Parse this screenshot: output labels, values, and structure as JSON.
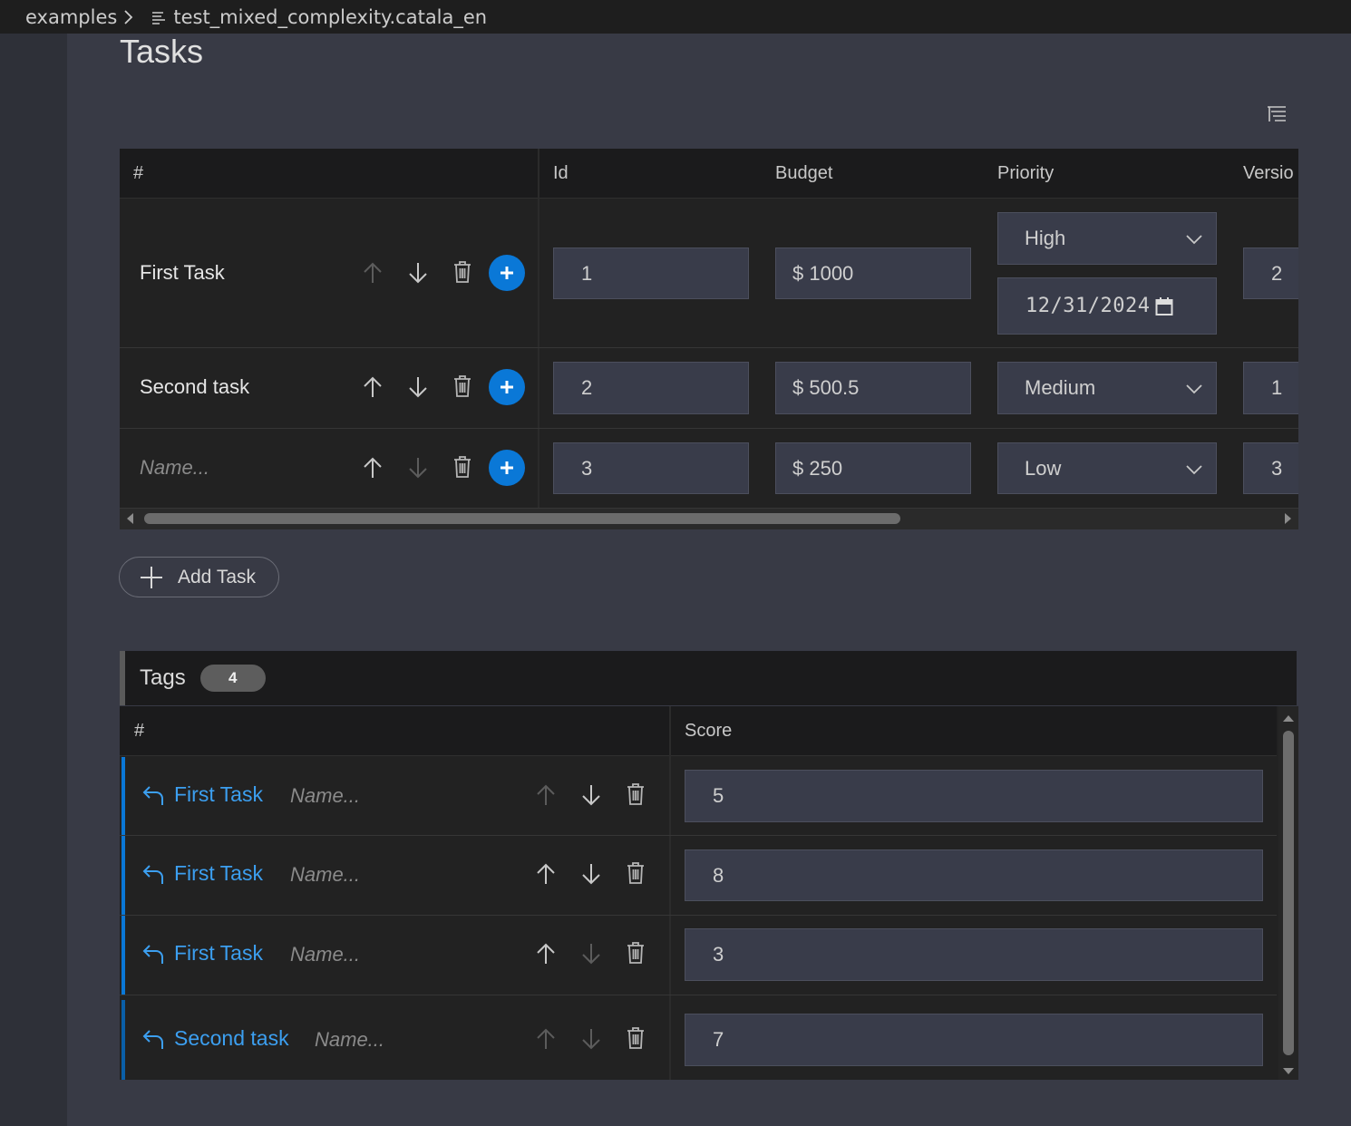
{
  "breadcrumb": {
    "folder": "examples",
    "file": "test_mixed_complexity.catala_en"
  },
  "page": {
    "title": "Tasks"
  },
  "icons": {
    "filter": "filter-lines-icon",
    "up": "arrow-up-icon",
    "down": "arrow-down-icon",
    "delete": "trash-icon",
    "add": "plus-icon",
    "reference": "back-reference-icon",
    "dropdown": "chevron-down-icon",
    "calendar": "calendar-icon"
  },
  "colors": {
    "accent": "#0a78d7",
    "link": "#3c9ff0",
    "background": "#383a45"
  },
  "tasks_table": {
    "columns": [
      "#",
      "Id",
      "Budget",
      "Priority",
      "Versio"
    ],
    "rows": [
      {
        "name": "First Task",
        "id": "1",
        "budget": "$ 1000",
        "priority": "High",
        "date": "12/31/2024",
        "version": "2"
      },
      {
        "name": "Second task",
        "id": "2",
        "budget": "$ 500.5",
        "priority": "Medium",
        "version": "1"
      },
      {
        "name": "",
        "name_placeholder": "Name...",
        "id": "3",
        "budget": "$ 250",
        "priority": "Low",
        "version": "3"
      }
    ]
  },
  "add_task": {
    "label": "Add Task"
  },
  "tags": {
    "title": "Tags",
    "count": "4",
    "columns": [
      "#",
      "Score"
    ],
    "rows": [
      {
        "ref": "First Task",
        "name_placeholder": "Name...",
        "score": "5"
      },
      {
        "ref": "First Task",
        "name_placeholder": "Name...",
        "score": "8"
      },
      {
        "ref": "First Task",
        "name_placeholder": "Name...",
        "score": "3"
      },
      {
        "ref": "Second task",
        "name_placeholder": "Name...",
        "score": "7"
      }
    ]
  }
}
